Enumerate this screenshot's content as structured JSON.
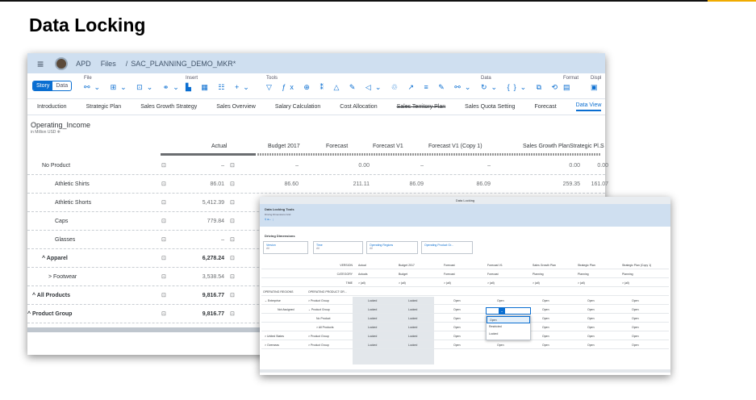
{
  "slide": {
    "title": "Data Locking"
  },
  "back": {
    "user": "APD",
    "files": "Files",
    "sep": "/",
    "file": "SAC_PLANNING_DEMO_MKR*",
    "story": "Story",
    "data": "Data",
    "groups": [
      {
        "label": "File",
        "icons": "⚯⌄ ⊞⌄ ⊡⌄ ⚭⌄"
      },
      {
        "label": "Insert",
        "icons": "▙ ▦ ☷ +⌄"
      },
      {
        "label": "Tools",
        "icons": "▽ ƒx ⊕ ⁑ △ ✎ ◁⌄ ♲ ↗ ≡ ✎ ⚯⌄"
      },
      {
        "label": "Data",
        "icons": "↻⌄ {}⌄ ⧉ ⟲"
      },
      {
        "label": "Format",
        "icons": "▤"
      },
      {
        "label": "Displ",
        "icons": "▣"
      }
    ],
    "tabs": [
      "Introduction",
      "Strategic Plan",
      "Sales Growth Strategy",
      "Sales Overview",
      "Salary Calculation",
      "Cost Allocation",
      "Sales Territory Plan",
      "Sales Quota Setting",
      "Forecast",
      "Data View"
    ],
    "table_title": "Operating_Income",
    "table_sub": "in Million USD ❄",
    "columns": [
      "Actual",
      "Budget 2017",
      "Forecast",
      "Forecast V1",
      "Forecast V1 (Copy 1)",
      "Sales Growth Plan",
      "Strategic Pl...",
      "S"
    ],
    "rows": [
      {
        "label": "No Product",
        "actual": "–",
        "budget": "–",
        "forecast": "0.00",
        "fv1": "–",
        "fcopy": "–",
        "sgp": "0.00",
        "sp": "0.00"
      },
      {
        "label": "Athletic Shirts",
        "actual": "86.01",
        "budget": "86.60",
        "forecast": "211.11",
        "fv1": "86.09",
        "fcopy": "86.09",
        "sgp": "259.35",
        "sp": "161.07"
      },
      {
        "label": "Athletic Shorts",
        "actual": "5,412.39",
        "budget": "",
        "forecast": "",
        "fv1": "",
        "fcopy": "",
        "sgp": "",
        "sp": ""
      },
      {
        "label": "Caps",
        "actual": "779.84",
        "budget": "",
        "forecast": "",
        "fv1": "",
        "fcopy": "",
        "sgp": "",
        "sp": ""
      },
      {
        "label": "Glasses",
        "actual": "–",
        "budget": "",
        "forecast": "",
        "fv1": "",
        "fcopy": "",
        "sgp": "",
        "sp": ""
      },
      {
        "label": "^ Apparel",
        "actual": "6,278.24",
        "budget": "",
        "forecast": "",
        "fv1": "",
        "fcopy": "",
        "sgp": "",
        "sp": ""
      },
      {
        "label": "> Footwear",
        "actual": "3,538.54",
        "budget": "",
        "forecast": "",
        "fv1": "",
        "fcopy": "",
        "sgp": "",
        "sp": ""
      },
      {
        "label": "^ All Products",
        "actual": "9,816.77",
        "budget": "",
        "forecast": "",
        "fv1": "",
        "fcopy": "",
        "sgp": "",
        "sp": ""
      },
      {
        "label": "^ Product Group",
        "actual": "9,816.77",
        "budget": "",
        "forecast": "",
        "fv1": "",
        "fcopy": "",
        "sgp": "",
        "sp": ""
      }
    ]
  },
  "front": {
    "head": "Data Locking",
    "tools_title": "Data Locking Tools",
    "tools_sub": "Driving Dimensions   Grid",
    "dd_title": "Driving Dimensions",
    "filters": [
      {
        "l": "Version",
        "v": "All"
      },
      {
        "l": "Time",
        "v": "All"
      },
      {
        "l": "Operating Regions",
        "v": "All"
      },
      {
        "l": "Operating Product Gr...",
        "v": ""
      }
    ],
    "hdr": {
      "version": "VERSION",
      "category": "CATEGORY",
      "time": "TIME",
      "opreg": "OPERATING REGIONS",
      "opprod": "OPERATING PRODUCT GR..."
    },
    "cols": [
      {
        "version": "Actual",
        "category": "Actuals",
        "time": "> (all)"
      },
      {
        "version": "Budget 2017",
        "category": "Budget",
        "time": "> (all)"
      },
      {
        "version": "Forecast",
        "category": "Forecast",
        "time": "> (all)"
      },
      {
        "version": "Forecast V1",
        "category": "Forecast",
        "time": "> (all)"
      },
      {
        "version": "Sales Growth Plan",
        "category": "Planning",
        "time": "> (all)"
      },
      {
        "version": "Strategic Plan",
        "category": "Planning",
        "time": "> (all)"
      },
      {
        "version": "Strategic Plan (Copy 1)",
        "category": "Planning",
        "time": "> (all)"
      }
    ],
    "rows": [
      {
        "r": "⌄ Enterprise",
        "p": "> Product Group",
        "c": [
          "Locked",
          "Locked",
          "Open",
          "Open",
          "Open",
          "Open",
          "Open"
        ]
      },
      {
        "r": "Not Assigned",
        "p": "⌄ Product Group",
        "c": [
          "Locked",
          "Locked",
          "Open",
          "Open",
          "Open",
          "Open",
          "Open"
        ]
      },
      {
        "r": "",
        "p": "No Product",
        "c": [
          "Locked",
          "Locked",
          "Open",
          "",
          "Open",
          "Open",
          "Open"
        ]
      },
      {
        "r": "",
        "p": "> All Products",
        "c": [
          "Locked",
          "Locked",
          "Open",
          "",
          "Open",
          "Open",
          "Open"
        ]
      },
      {
        "r": "> United States",
        "p": "> Product Group",
        "c": [
          "Locked",
          "Locked",
          "Open",
          "",
          "Open",
          "Open",
          "Open"
        ]
      },
      {
        "r": "> Overseas",
        "p": "> Product Group",
        "c": [
          "Locked",
          "Locked",
          "Open",
          "Open",
          "Open",
          "Open",
          "Open"
        ]
      }
    ],
    "dropdown": {
      "value": "Open",
      "options": [
        "Open",
        "Restricted",
        "Locked"
      ]
    }
  }
}
